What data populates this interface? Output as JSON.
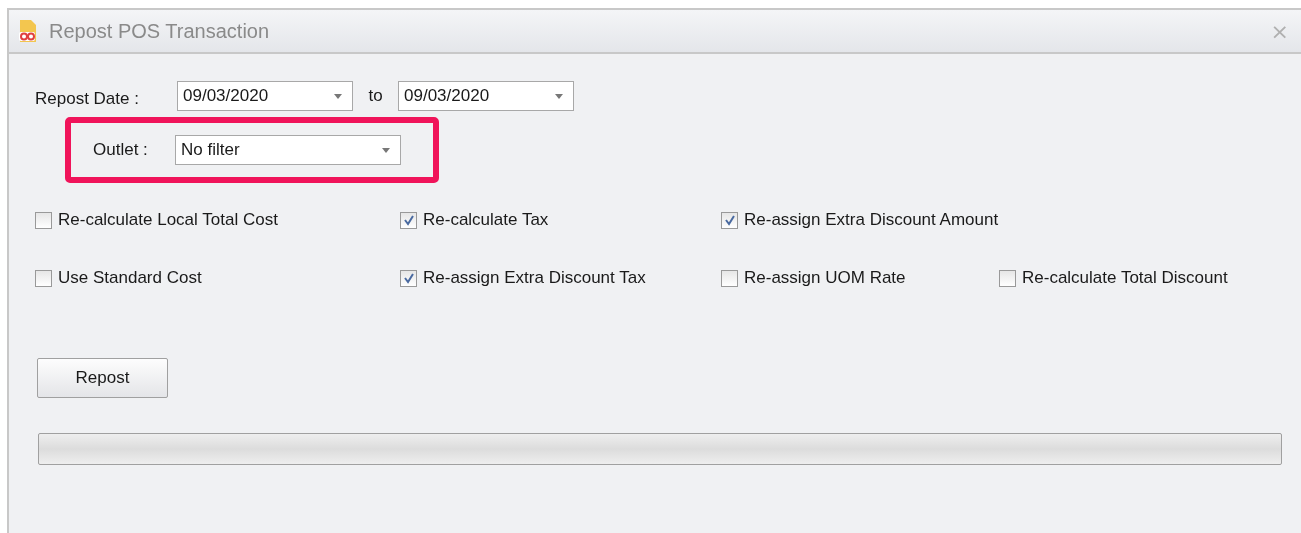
{
  "window": {
    "title": "Repost POS Transaction",
    "close": "×"
  },
  "repost_date": {
    "label": "Repost Date :",
    "from": "09/03/2020",
    "separator": "to",
    "to": "09/03/2020"
  },
  "outlet": {
    "label": "Outlet :",
    "value": "No filter",
    "highlighted": true
  },
  "options": [
    [
      {
        "label": "Re-calculate Local Total Cost",
        "checked": false
      },
      {
        "label": "Re-calculate Tax",
        "checked": true
      },
      {
        "label": "Re-assign Extra Discount Amount",
        "checked": true
      }
    ],
    [
      {
        "label": "Use Standard Cost",
        "checked": false
      },
      {
        "label": "Re-assign Extra Discount Tax",
        "checked": true
      },
      {
        "label": "Re-assign UOM Rate",
        "checked": false
      },
      {
        "label": "Re-calculate Total Discount",
        "checked": false
      }
    ]
  ],
  "repost_button": "Repost",
  "progress": {
    "level": 0
  }
}
